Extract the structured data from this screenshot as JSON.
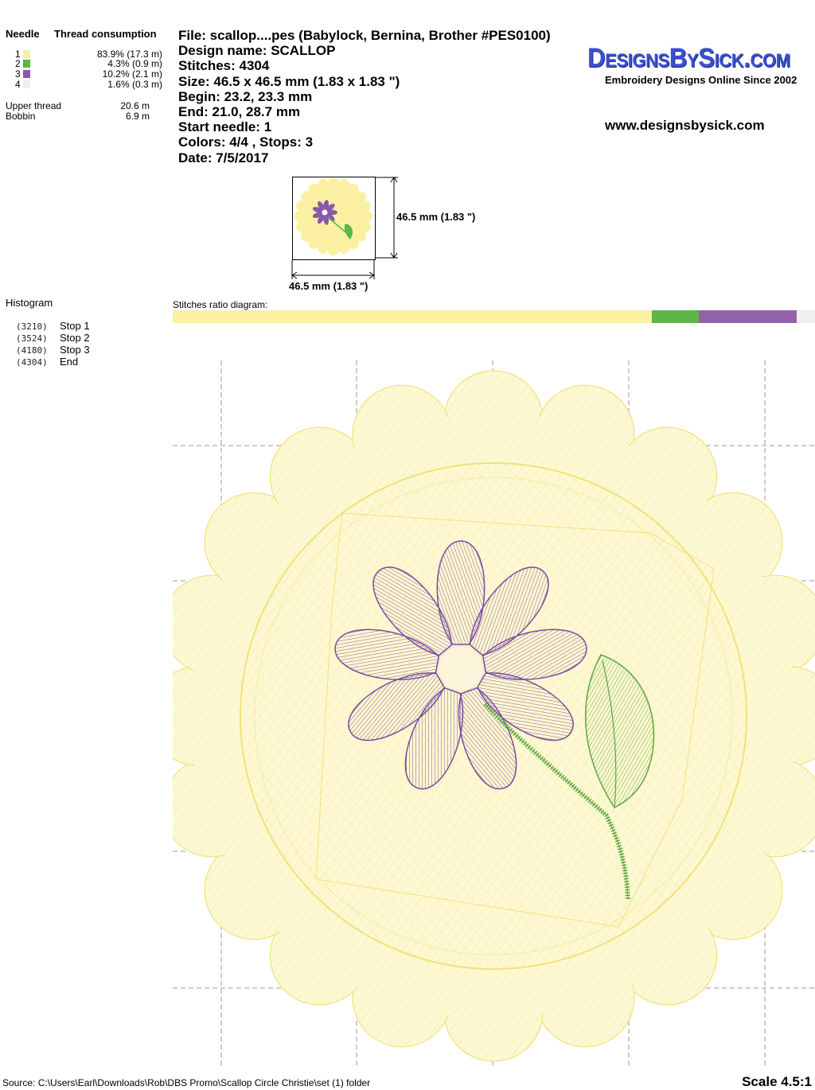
{
  "thread_table": {
    "header_needle": "Needle",
    "header_consumption": "Thread consumption",
    "rows": [
      {
        "needle": "1",
        "color": "#f7eea0",
        "consumption": "83.9% (17.3 m)"
      },
      {
        "needle": "2",
        "color": "#5bb548",
        "consumption": "4.3% (0.9 m)"
      },
      {
        "needle": "3",
        "color": "#8a58a8",
        "consumption": "10.2% (2.1 m)"
      },
      {
        "needle": "4",
        "color": "#efefef",
        "consumption": "1.6% (0.3 m)"
      }
    ],
    "upper_thread_label": "Upper thread",
    "upper_thread_value": "20.6 m",
    "bobbin_label": "Bobbin",
    "bobbin_value": "6.9 m"
  },
  "info": {
    "file": "File: scallop....pes  (Babylock, Bernina, Brother #PES0100)",
    "design_name": "Design name: SCALLOP",
    "stitches": "Stitches: 4304",
    "size": "Size: 46.5 x 46.5 mm (1.83 x 1.83 \")",
    "begin": "Begin: 23.2, 23.3 mm",
    "end": "End: 21.0, 28.7 mm",
    "start_needle": "Start needle: 1",
    "colors_stops": "Colors: 4/4 , Stops: 3",
    "date": "Date: 7/5/2017"
  },
  "brand": {
    "logo": "DesignsBySick.com",
    "tagline": "Embroidery Designs Online Since 2002",
    "url": "www.designsbysick.com"
  },
  "thumbnail": {
    "height_label": "46.5 mm (1.83 \")",
    "width_label": "46.5 mm (1.83 \")"
  },
  "histogram": {
    "title": "Histogram",
    "stops": [
      {
        "count": "(3210)",
        "label": "Stop 1"
      },
      {
        "count": "(3524)",
        "label": "Stop 2"
      },
      {
        "count": "(4180)",
        "label": "Stop 3"
      },
      {
        "count": "(4304)",
        "label": "End"
      }
    ]
  },
  "ratio": {
    "label": "Stitches ratio diagram:",
    "segments": [
      {
        "color": "#fbf0a2",
        "percent": 74.6
      },
      {
        "color": "#5fb548",
        "percent": 7.3
      },
      {
        "color": "#9462ad",
        "percent": 15.2
      },
      {
        "color": "#efefef",
        "percent": 2.9
      }
    ]
  },
  "colors": {
    "yellow": "#f4e88a",
    "yellow_light": "#fbf5c8",
    "purple": "#7a4aa0",
    "green": "#5aa83e",
    "grid": "#999999"
  },
  "footer": {
    "source": "Source: C:\\Users\\Earl\\Downloads\\Rob\\DBS Promo\\Scallop Circle Christie\\set (1) folder",
    "scale": "Scale 4.5:1"
  }
}
